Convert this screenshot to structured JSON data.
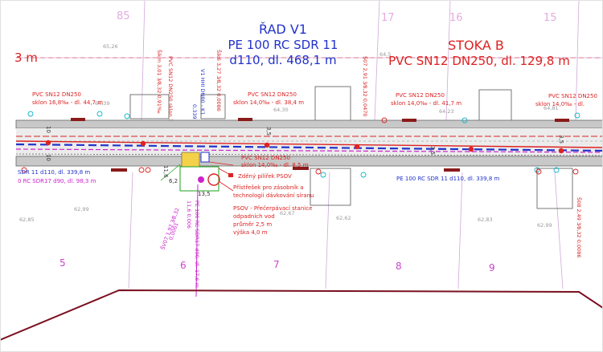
{
  "colors": {
    "blue": "#2233cc",
    "red": "#dd2222",
    "magenta": "#cc22cc",
    "darkred": "#8b0000",
    "grey": "#8a8a8a",
    "cyan": "#11b5c8",
    "yellow": "#f3d24a",
    "green": "#1ea21e",
    "frame": "#7a1020"
  },
  "top_numbers": [
    "17",
    "16",
    "15",
    "85"
  ],
  "rad": {
    "title": "ŘAD V1",
    "spec": "PE 100 RC SDR 11",
    "dims": "d110, dl. 468,1 m"
  },
  "stoka": {
    "title": "STOKA B",
    "spec": "PVC SN12 DN250, dl. 129,8 m"
  },
  "left_m": "3 m",
  "small_elev": [
    "65,26",
    "64,5",
    "62,99",
    "62,67",
    "62,62",
    "62,83",
    "62,99",
    "62,85",
    "64,39",
    "64,23",
    "64,81",
    "64,30"
  ],
  "pvc_labels": [
    {
      "line1": "PVC SN12 DN250",
      "line2": "sklon 16,8‰ - dl. 44,7 m"
    },
    {
      "line1": "PVC SN12 DN250",
      "line2": "sklon 14,0‰ - dl. 38,4 m"
    },
    {
      "line1": "PVC SN12 DN250",
      "line2": "sklon 14,0‰ - dl. 41,7 m"
    },
    {
      "line1": "PVC SN12 DN250",
      "line2": "sklon 14,0‰ - dl."
    }
  ],
  "vertical_red": [
    "Šikm 3,01 3⁄8,32 0,91‰",
    "PVC SN12 DN250 sklon 16,0‰ - dl. 8,4 m",
    "Šik6 3,27 3⁄8,32 0,0086",
    "Š07 2,91 3⁄8,32 0,0470",
    "Š08 2,49 3⁄8,32 0,0086"
  ],
  "vertical_blue": [
    "V1 HHI DN80 - K1",
    "0,3391"
  ],
  "num_10": [
    "10",
    "10"
  ],
  "num_35": [
    "3,5",
    "3,5",
    "3,5"
  ],
  "pipe_center_label": {
    "line1": "PVC SN12 DN250",
    "line2": "sklon 14,0‰ - dl. 8,5 m"
  },
  "legend_red": [
    "Zděný pilířek PSOV",
    "Přístřešek pro zásobník a",
    "technologii dávkování síranu",
    "PSOV - Přečerpávací stanice",
    "odpadních vod",
    "průměr 2,5 m",
    "výška 4,0 m"
  ],
  "dim_station": [
    "6,2",
    "13,5",
    "11,6"
  ],
  "blue_bottom_left": "SDR 11 d110, dl. 339,8 m",
  "magenta_bottom_left": "0 RC SDR17 d90, dl. 98,3 m",
  "blue_bottom_right": "PE 100 RC SDR 11 d110, dl. 339,8 m",
  "magenta_vertical": [
    "PE 100 RC SDR17 d90, dl. 17,6 m",
    "11,6 0,006"
  ],
  "magenta_slant": [
    "ŠV07 1,92 3⁄8,32",
    "0,0061"
  ],
  "plot_numbers": [
    "5",
    "6",
    "7",
    "8",
    "9"
  ]
}
